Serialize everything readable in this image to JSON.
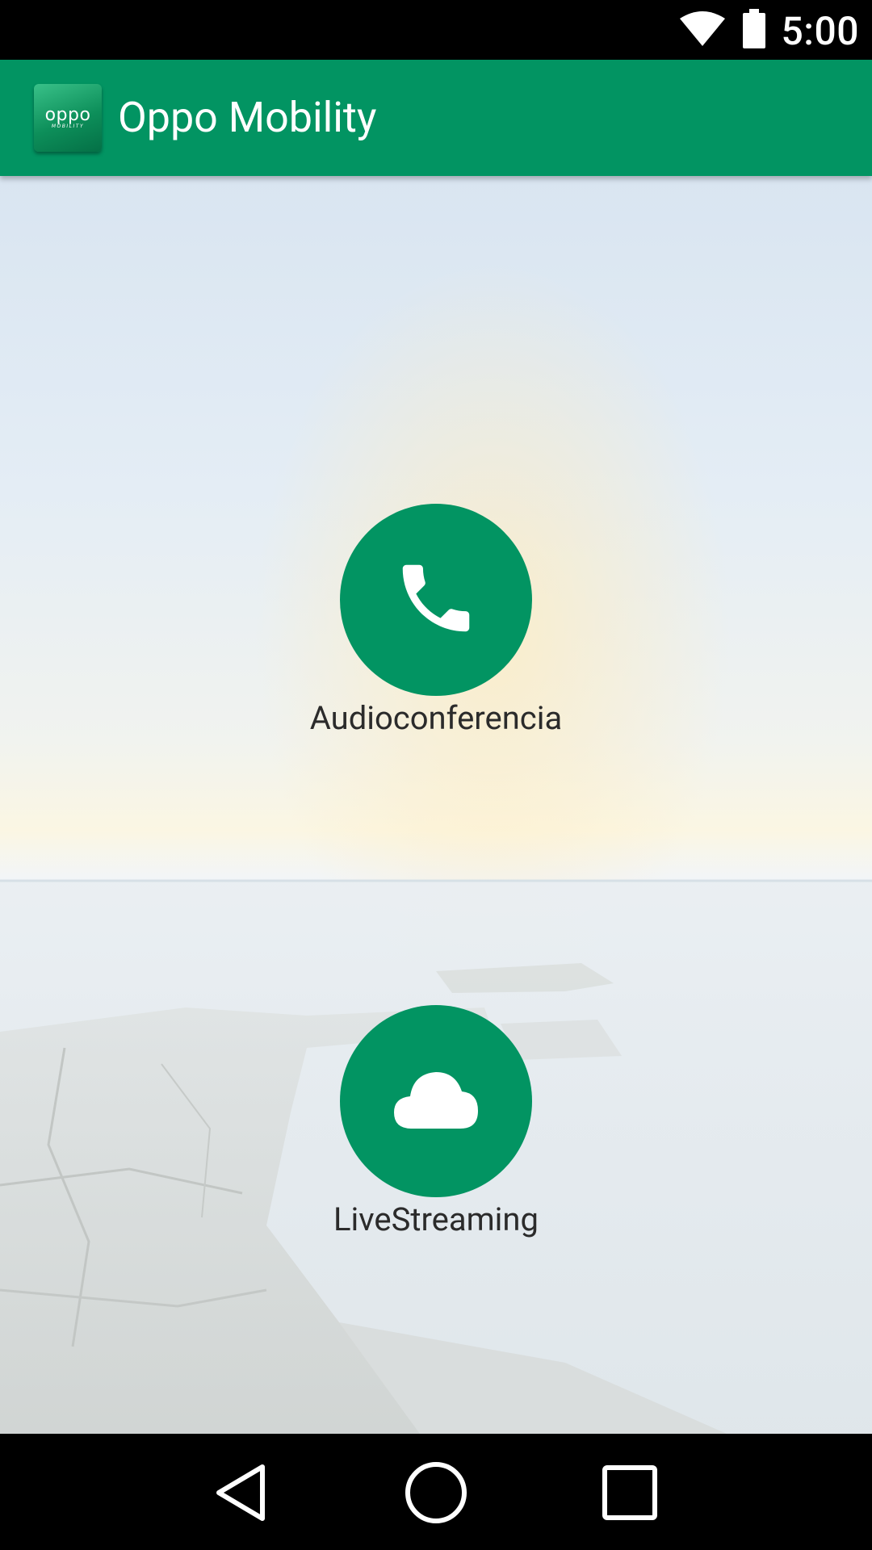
{
  "status_bar": {
    "time": "5:00",
    "icons": [
      "wifi-icon",
      "battery-icon"
    ]
  },
  "app_bar": {
    "logo_text": "oppo",
    "logo_subtext": "MOBILITY",
    "title": "Oppo Mobility",
    "background_color": "#029462"
  },
  "actions": [
    {
      "label": "Audioconferencia",
      "icon": "phone-icon"
    },
    {
      "label": "LiveStreaming",
      "icon": "cloud-icon"
    }
  ],
  "nav_bar": {
    "buttons": [
      "back-icon",
      "home-icon",
      "recents-icon"
    ]
  }
}
